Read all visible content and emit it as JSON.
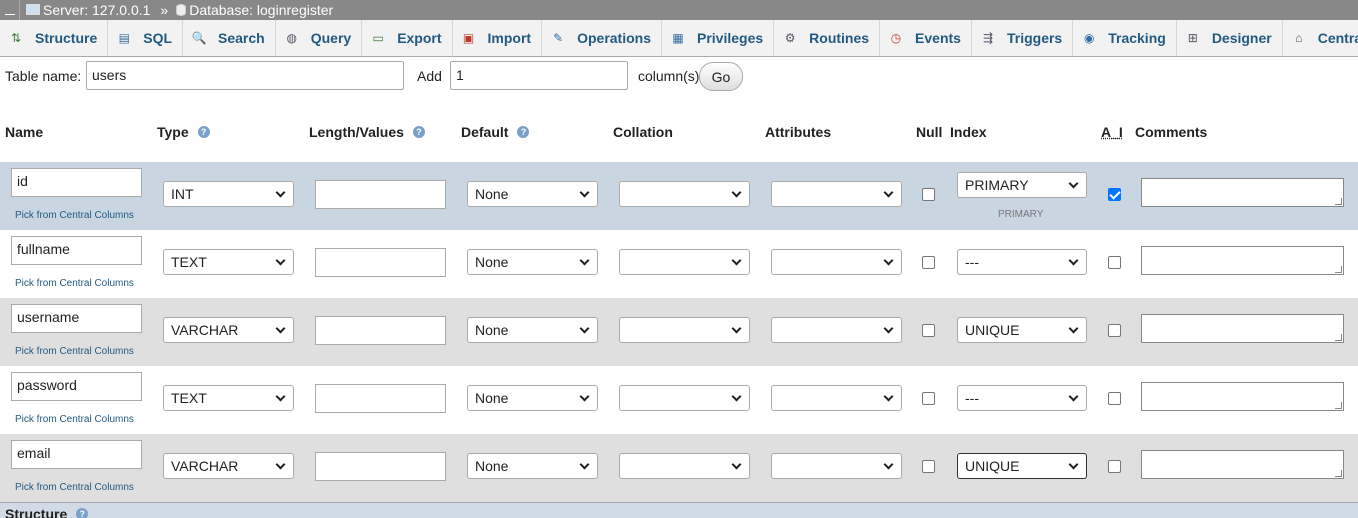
{
  "breadcrumb": {
    "server": "Server: 127.0.0.1",
    "separator": "»",
    "database": "Database: loginregister"
  },
  "tabs": [
    {
      "label": "Structure",
      "icon": "structure-icon",
      "glyph": "⇅"
    },
    {
      "label": "SQL",
      "icon": "sql-icon",
      "glyph": "▤"
    },
    {
      "label": "Search",
      "icon": "search-icon",
      "glyph": "🔍"
    },
    {
      "label": "Query",
      "icon": "query-icon",
      "glyph": "◍"
    },
    {
      "label": "Export",
      "icon": "export-icon",
      "glyph": "▭"
    },
    {
      "label": "Import",
      "icon": "import-icon",
      "glyph": "▣"
    },
    {
      "label": "Operations",
      "icon": "wrench-icon",
      "glyph": "✎"
    },
    {
      "label": "Privileges",
      "icon": "privileges-icon",
      "glyph": "▦"
    },
    {
      "label": "Routines",
      "icon": "routines-icon",
      "glyph": "⚙"
    },
    {
      "label": "Events",
      "icon": "clock-icon",
      "glyph": "◷"
    },
    {
      "label": "Triggers",
      "icon": "triggers-icon",
      "glyph": "⇶"
    },
    {
      "label": "Tracking",
      "icon": "eye-icon",
      "glyph": "◉"
    },
    {
      "label": "Designer",
      "icon": "designer-icon",
      "glyph": "⊞"
    },
    {
      "label": "Central columns",
      "icon": "central-columns-icon",
      "glyph": "⌂"
    }
  ],
  "form": {
    "table_name_label": "Table name:",
    "table_name_value": "users",
    "add_label": "Add",
    "add_value": "1",
    "columns_label": "column(s)",
    "go_label": "Go"
  },
  "headers": {
    "name": "Name",
    "type": "Type",
    "length": "Length/Values",
    "default": "Default",
    "collation": "Collation",
    "attributes": "Attributes",
    "null": "Null",
    "index": "Index",
    "ai": "A_I",
    "comments": "Comments"
  },
  "pick_label": "Pick from Central Columns",
  "rows": [
    {
      "name": "id",
      "type": "INT",
      "default": "None",
      "index": "PRIMARY",
      "index_note": "PRIMARY",
      "ai": true,
      "null": false
    },
    {
      "name": "fullname",
      "type": "TEXT",
      "default": "None",
      "index": "---",
      "index_note": "",
      "ai": false,
      "null": false
    },
    {
      "name": "username",
      "type": "VARCHAR",
      "default": "None",
      "index": "UNIQUE",
      "index_note": "",
      "ai": false,
      "null": false
    },
    {
      "name": "password",
      "type": "TEXT",
      "default": "None",
      "index": "---",
      "index_note": "",
      "ai": false,
      "null": false
    },
    {
      "name": "email",
      "type": "VARCHAR",
      "default": "None",
      "index": "UNIQUE",
      "index_note": "",
      "ai": false,
      "null": false
    }
  ],
  "footer": {
    "structure_label": "Structure"
  },
  "colors": {
    "tab_text": "#235a81",
    "row_highlight": "#c9d5e1",
    "row_odd": "#dfdfdf",
    "checkbox_checked": "#0075ff"
  }
}
